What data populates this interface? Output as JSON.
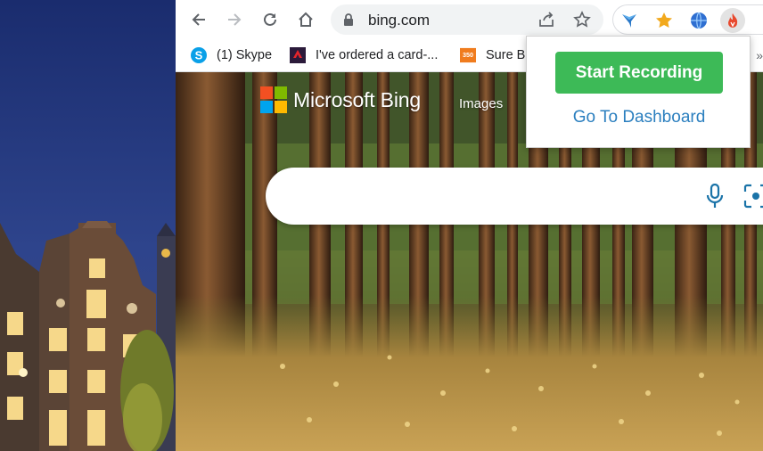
{
  "browser": {
    "nav": {
      "back": "back-arrow-icon",
      "forward": "forward-arrow-icon",
      "reload": "reload-icon",
      "home": "home-icon"
    },
    "omnibox": {
      "url": "bing.com"
    },
    "extensions": [
      "lightning-bolt-extension-icon",
      "star-extension-icon",
      "globe-extension-icon",
      "recorder-extension-icon"
    ],
    "bookmarks": [
      {
        "label": "(1) Skype",
        "icon": "skype-icon"
      },
      {
        "label": "I've ordered a card-...",
        "icon": "bank-icon"
      },
      {
        "label": "Sure Be",
        "icon": "site-350-icon"
      }
    ]
  },
  "page": {
    "logo_text": "Microsoft Bing",
    "nav_images": "Images"
  },
  "popup": {
    "start_label": "Start Recording",
    "dashboard_label": "Go To Dashboard"
  },
  "colors": {
    "start_button": "#3dba57",
    "dashboard_link": "#2b7fbf",
    "omnibox_bg": "#f1f3f4"
  }
}
